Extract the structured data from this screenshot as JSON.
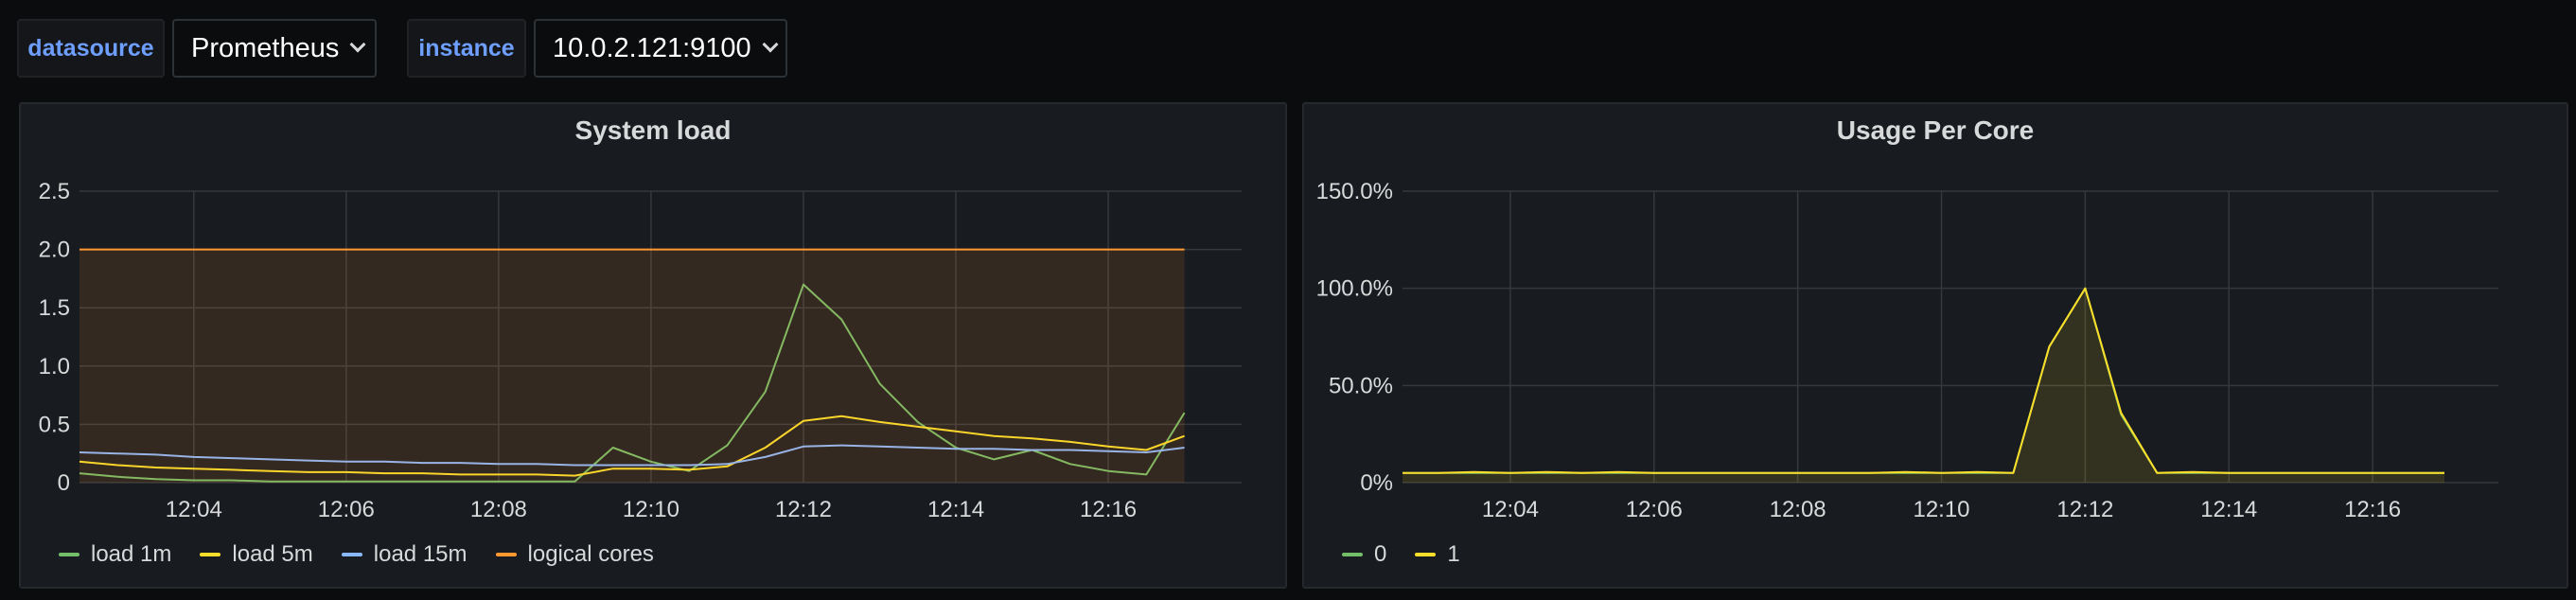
{
  "variables": [
    {
      "label": "datasource",
      "value": "Prometheus"
    },
    {
      "label": "instance",
      "value": "10.0.2.121:9100"
    }
  ],
  "panels": [
    {
      "title": "System load"
    },
    {
      "title": "Usage Per Core"
    }
  ],
  "chart_data": [
    {
      "type": "line",
      "title": "System load",
      "x": [
        "12:02:30",
        "12:03",
        "12:03:30",
        "12:04",
        "12:04:30",
        "12:05",
        "12:05:30",
        "12:06",
        "12:06:30",
        "12:07",
        "12:07:30",
        "12:08",
        "12:08:30",
        "12:09",
        "12:09:30",
        "12:10",
        "12:10:30",
        "12:11",
        "12:11:30",
        "12:12",
        "12:12:30",
        "12:13",
        "12:13:30",
        "12:14",
        "12:14:30",
        "12:15",
        "12:15:30",
        "12:16",
        "12:16:30",
        "12:17"
      ],
      "xticks": [
        "12:04",
        "12:06",
        "12:08",
        "12:10",
        "12:12",
        "12:14",
        "12:16"
      ],
      "ylim": [
        0,
        2.5
      ],
      "yticks": [
        "0",
        "0.5",
        "1.0",
        "1.5",
        "2.0",
        "2.5"
      ],
      "series": [
        {
          "name": "load 1m",
          "color": "#73bf69",
          "values": [
            0.08,
            0.05,
            0.03,
            0.02,
            0.02,
            0.01,
            0.01,
            0.01,
            0.01,
            0.01,
            0.01,
            0.01,
            0.01,
            0.01,
            0.3,
            0.18,
            0.1,
            0.32,
            0.78,
            1.7,
            1.4,
            0.85,
            0.52,
            0.3,
            0.2,
            0.28,
            0.16,
            0.1,
            0.07,
            0.6
          ]
        },
        {
          "name": "load 5m",
          "color": "#fade2a",
          "values": [
            0.18,
            0.15,
            0.13,
            0.12,
            0.11,
            0.1,
            0.09,
            0.09,
            0.08,
            0.08,
            0.07,
            0.07,
            0.07,
            0.06,
            0.12,
            0.12,
            0.11,
            0.14,
            0.3,
            0.53,
            0.57,
            0.52,
            0.48,
            0.44,
            0.4,
            0.38,
            0.35,
            0.31,
            0.28,
            0.4
          ]
        },
        {
          "name": "load 15m",
          "color": "#8ab8ff",
          "values": [
            0.26,
            0.25,
            0.24,
            0.22,
            0.21,
            0.2,
            0.19,
            0.18,
            0.18,
            0.17,
            0.17,
            0.16,
            0.16,
            0.15,
            0.15,
            0.15,
            0.15,
            0.16,
            0.22,
            0.31,
            0.32,
            0.31,
            0.3,
            0.29,
            0.29,
            0.28,
            0.28,
            0.27,
            0.26,
            0.3
          ]
        },
        {
          "name": "logical cores",
          "color": "#ff9830",
          "values": [
            2,
            2,
            2,
            2,
            2,
            2,
            2,
            2,
            2,
            2,
            2,
            2,
            2,
            2,
            2,
            2,
            2,
            2,
            2,
            2,
            2,
            2,
            2,
            2,
            2,
            2,
            2,
            2,
            2,
            2
          ]
        }
      ]
    },
    {
      "type": "line",
      "title": "Usage Per Core",
      "x": [
        "12:02:30",
        "12:03",
        "12:03:30",
        "12:04",
        "12:04:30",
        "12:05",
        "12:05:30",
        "12:06",
        "12:06:30",
        "12:07",
        "12:07:30",
        "12:08",
        "12:08:30",
        "12:09",
        "12:09:30",
        "12:10",
        "12:10:30",
        "12:11",
        "12:11:30",
        "12:12",
        "12:12:30",
        "12:13",
        "12:13:30",
        "12:14",
        "12:14:30",
        "12:15",
        "12:15:30",
        "12:16",
        "12:16:30",
        "12:17"
      ],
      "xticks": [
        "12:04",
        "12:06",
        "12:08",
        "12:10",
        "12:12",
        "12:14",
        "12:16"
      ],
      "ylim": [
        0,
        150
      ],
      "yticks": [
        "0%",
        "50.0%",
        "100.0%",
        "150.0%"
      ],
      "series": [
        {
          "name": "0",
          "color": "#73bf69",
          "values": [
            5,
            5,
            5,
            5,
            5,
            5,
            5,
            5,
            5,
            5,
            5,
            5,
            5,
            5,
            5,
            5,
            5,
            5,
            70,
            100,
            35,
            5,
            5,
            5,
            5,
            5,
            5,
            5,
            5,
            5
          ]
        },
        {
          "name": "1",
          "color": "#fade2a",
          "values": [
            5,
            5,
            5.5,
            5,
            5.5,
            5,
            5.5,
            5,
            5,
            5,
            5,
            5,
            5,
            5,
            5.5,
            5,
            5.5,
            5,
            70,
            100,
            36,
            5,
            5.5,
            5,
            5,
            5,
            5,
            5,
            5,
            5
          ]
        }
      ]
    }
  ]
}
